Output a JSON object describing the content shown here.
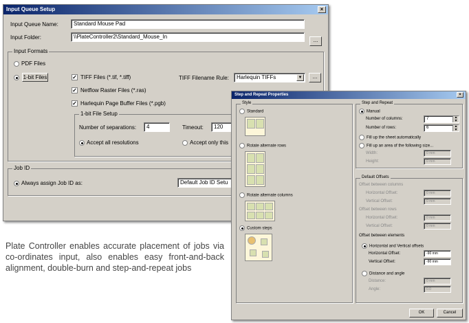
{
  "main_dialog": {
    "title": "Input Queue Setup",
    "close_glyph": "×",
    "queue_name_label": "Input Queue Name:",
    "queue_name_value": "Standard Mouse Pad",
    "folder_label": "Input Folder:",
    "folder_value": "\\\\PlateController2\\Standard_Mouse_In",
    "browse_label": "...",
    "formats_group_label": "Input Formats",
    "pdf_files_label": "PDF Files",
    "onebit_button_label": "1-bit Files",
    "tiff_label": "TIFF Files (*.tif, *.tiff)",
    "tiff_rule_label": "TIFF Filename Rule:",
    "tiff_rule_value": "Harlequin TIFFs",
    "tiff_rule_button": "...",
    "netflow_label": "Netflow Raster Files (*.ras)",
    "harlequin_label": "Harlequin Page Buffer Files (*.pgb)",
    "onebit_setup_label": "1-bit File Setup",
    "separations_label": "Number of separations:",
    "separations_value": "4",
    "timeout_label": "Timeout:",
    "timeout_value": "120",
    "accept_all_label": "Accept all resolutions",
    "accept_only_label": "Accept only this",
    "jobid_group_label": "Job ID",
    "assign_jobid_label": "Always assign Job ID as:",
    "jobid_value": "Default Job ID Setu"
  },
  "step_dialog": {
    "title": "Step and Repeat Properties",
    "close_glyph": "×",
    "style_label": "Style",
    "styles": [
      "Standard",
      "Rotate alternate rows",
      "Rotate alternate columns",
      "Custom steps"
    ],
    "step_repeat_label": "Step and Repeat",
    "manual_label": "Manual",
    "columns_label": "Number of columns:",
    "columns_value": "7",
    "rows_label": "Number of rows:",
    "rows_value": "6",
    "fill_sheet_label": "Fill up the sheet automatically",
    "fill_area_label": "Fill up an area of the following size...",
    "width_label": "Width:",
    "width_value": "0 mm",
    "height_label": "Height:",
    "height_value": "0 mm",
    "default_offsets_label": "Default Offsets",
    "offset_columns_label": "Offset between columns",
    "offset_rows_label": "Offset between rows",
    "horizontal_offset_label": "Horizontal Offset:",
    "vertical_offset_label": "Vertical Offset:",
    "offset_disabled_value": "0 mm",
    "offset_elements_label": "Offset between elements",
    "hv_offsets_label": "Horizontal and Vertical offsets",
    "horizontal_value": "-90 mm",
    "vertical_value": "-90 mm",
    "distance_angle_label": "Distance and angle",
    "distance_label": "Distance:",
    "distance_value": "0 mm",
    "angle_label": "Angle:",
    "angle_value": "0.0",
    "ok_label": "OK",
    "cancel_label": "Cancel"
  },
  "caption_text": "Plate Controller enables accurate placement of jobs via co-ordinates input, also enables easy front-and-back alignment, double-burn and step-and-repeat jobs"
}
